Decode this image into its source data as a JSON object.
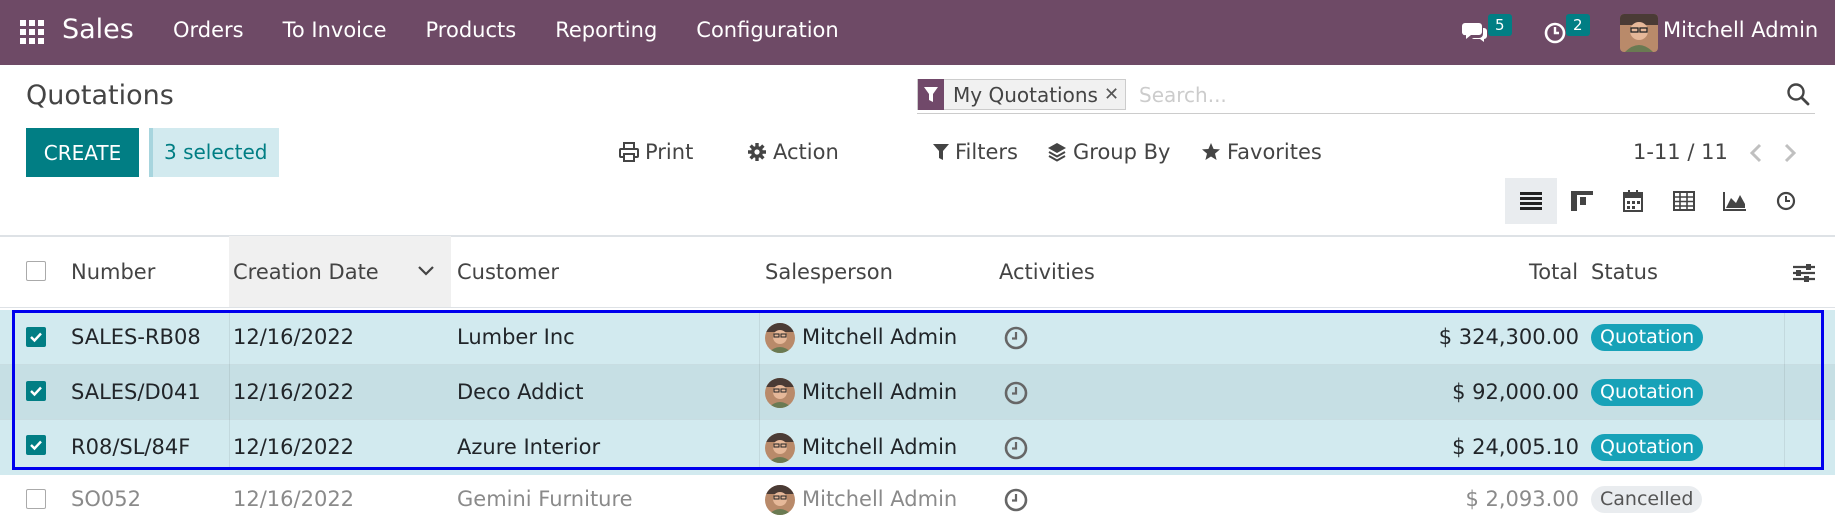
{
  "navbar": {
    "brand": "Sales",
    "menu": [
      "Orders",
      "To Invoice",
      "Products",
      "Reporting",
      "Configuration"
    ],
    "chat_count": "5",
    "activity_count": "2",
    "user_name": "Mitchell Admin",
    "bg_color": "#6e4a66"
  },
  "control_panel": {
    "title": "Quotations",
    "search": {
      "facet_label": "My Quotations",
      "placeholder": "Search..."
    },
    "create_label": "CREATE",
    "selected_label": "3 selected",
    "print_label": "Print",
    "action_label": "Action",
    "filters_label": "Filters",
    "groupby_label": "Group By",
    "favorites_label": "Favorites",
    "pager": "1-11 / 11",
    "views": [
      "list-icon",
      "kanban-icon",
      "calendar-icon",
      "pivot-icon",
      "graph-icon",
      "activity-icon"
    ]
  },
  "table": {
    "headers": {
      "number": "Number",
      "creation_date": "Creation Date",
      "customer": "Customer",
      "salesperson": "Salesperson",
      "activities": "Activities",
      "total": "Total",
      "status": "Status"
    },
    "rows": [
      {
        "number": "SALES-RB08",
        "date": "12/16/2022",
        "customer": "Lumber Inc",
        "salesperson": "Mitchell Admin",
        "total": "$ 324,300.00",
        "status": "Quotation",
        "selected": true
      },
      {
        "number": "SALES/D041",
        "date": "12/16/2022",
        "customer": "Deco Addict",
        "salesperson": "Mitchell Admin",
        "total": "$ 92,000.00",
        "status": "Quotation",
        "selected": true
      },
      {
        "number": "R08/SL/84F",
        "date": "12/16/2022",
        "customer": "Azure Interior",
        "salesperson": "Mitchell Admin",
        "total": "$ 24,005.10",
        "status": "Quotation",
        "selected": true
      },
      {
        "number": "SO052",
        "date": "12/16/2022",
        "customer": "Gemini Furniture",
        "salesperson": "Mitchell Admin",
        "total": "$ 2,093.00",
        "status": "Cancelled",
        "selected": false
      }
    ]
  },
  "colors": {
    "primary": "#017e84",
    "selected_row": "#d2eaef",
    "quotation_badge": "#17a2b8",
    "highlight": "#0000ee"
  }
}
